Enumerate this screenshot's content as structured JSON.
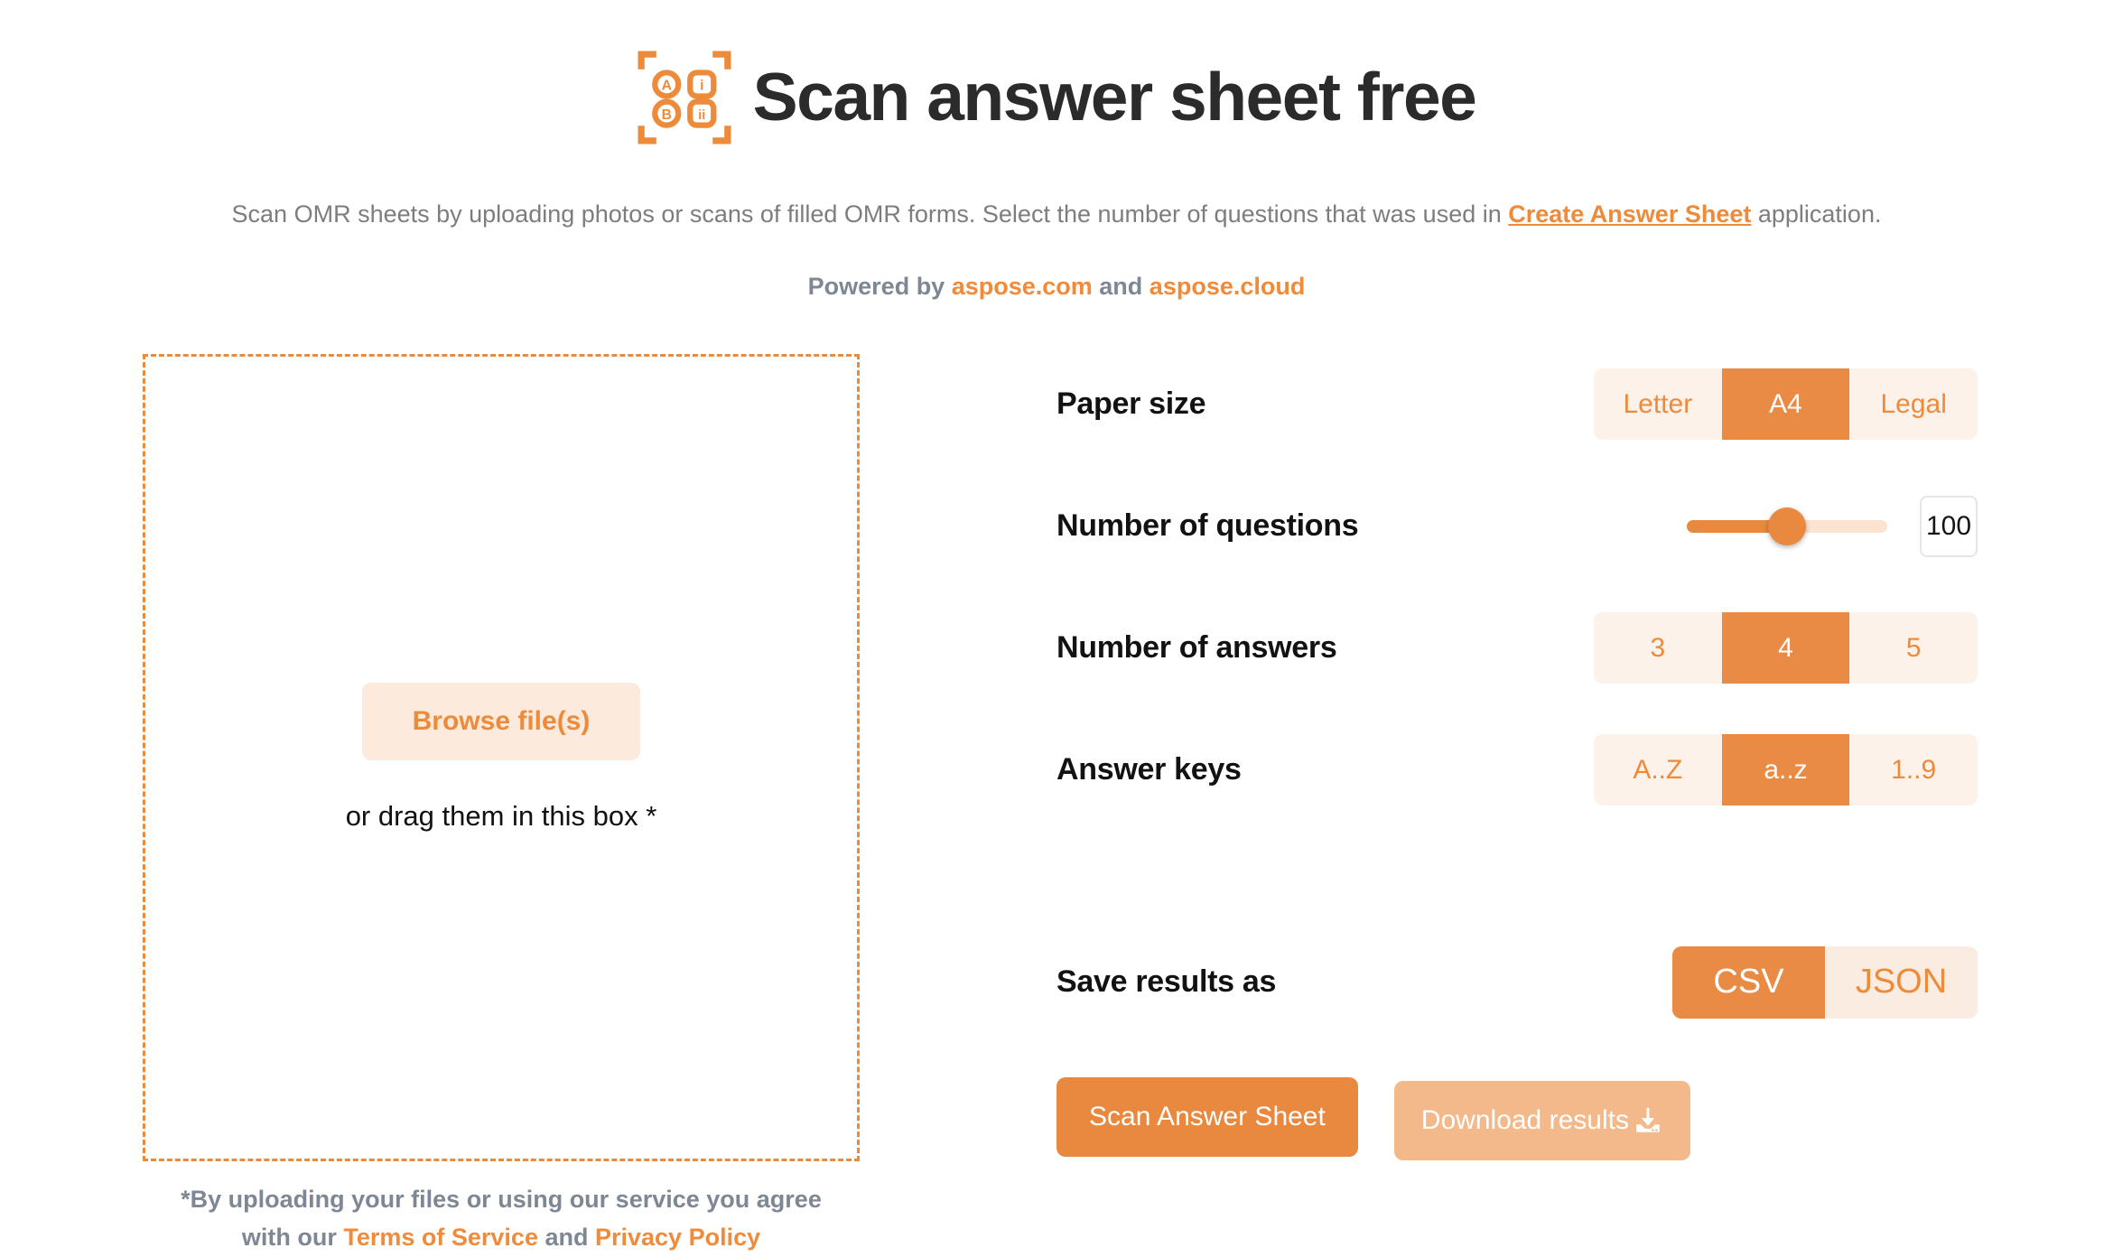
{
  "header": {
    "logo_icon": "omr-scan-frame-icon",
    "logo_cells": [
      "A",
      "B",
      "i",
      "ii"
    ],
    "title": "Scan answer sheet free",
    "subtitle_before": "Scan OMR sheets by uploading photos or scans of filled OMR forms. Select the number of questions that was used in ",
    "subtitle_link": "Create Answer Sheet",
    "subtitle_after": " application.",
    "powered_prefix": "Powered by ",
    "powered_link1": "aspose.com",
    "powered_middle": " and ",
    "powered_link2": "aspose.cloud"
  },
  "dropzone": {
    "browse_label": "Browse file(s)",
    "drag_text": "or drag them in this box *",
    "agreement_line1": "*By uploading your files or using our service you agree",
    "agreement_line2_prefix": "with our ",
    "agreement_terms": "Terms of Service",
    "agreement_and": " and ",
    "agreement_privacy": "Privacy Policy"
  },
  "settings": {
    "paper_size": {
      "label": "Paper size",
      "options": [
        "Letter",
        "A4",
        "Legal"
      ],
      "selected": "A4"
    },
    "num_questions": {
      "label": "Number of questions",
      "value": "100",
      "percent": 50
    },
    "num_answers": {
      "label": "Number of answers",
      "options": [
        "3",
        "4",
        "5"
      ],
      "selected": "4"
    },
    "answer_keys": {
      "label": "Answer keys",
      "options": [
        "A..Z",
        "a..z",
        "1..9"
      ],
      "selected": "a..z"
    },
    "save_results_as": {
      "label": "Save results as",
      "options": [
        "CSV",
        "JSON"
      ],
      "selected": "CSV"
    }
  },
  "actions": {
    "scan_label": "Scan Answer Sheet",
    "download_label": "Download results",
    "download_icon": "download-icon"
  },
  "colors": {
    "accent": "#E9893F",
    "accent_light": "#FDF2E9",
    "accent_text": "#ED8B3B",
    "muted": "#7e8794",
    "disabled": "#F3B98A"
  }
}
